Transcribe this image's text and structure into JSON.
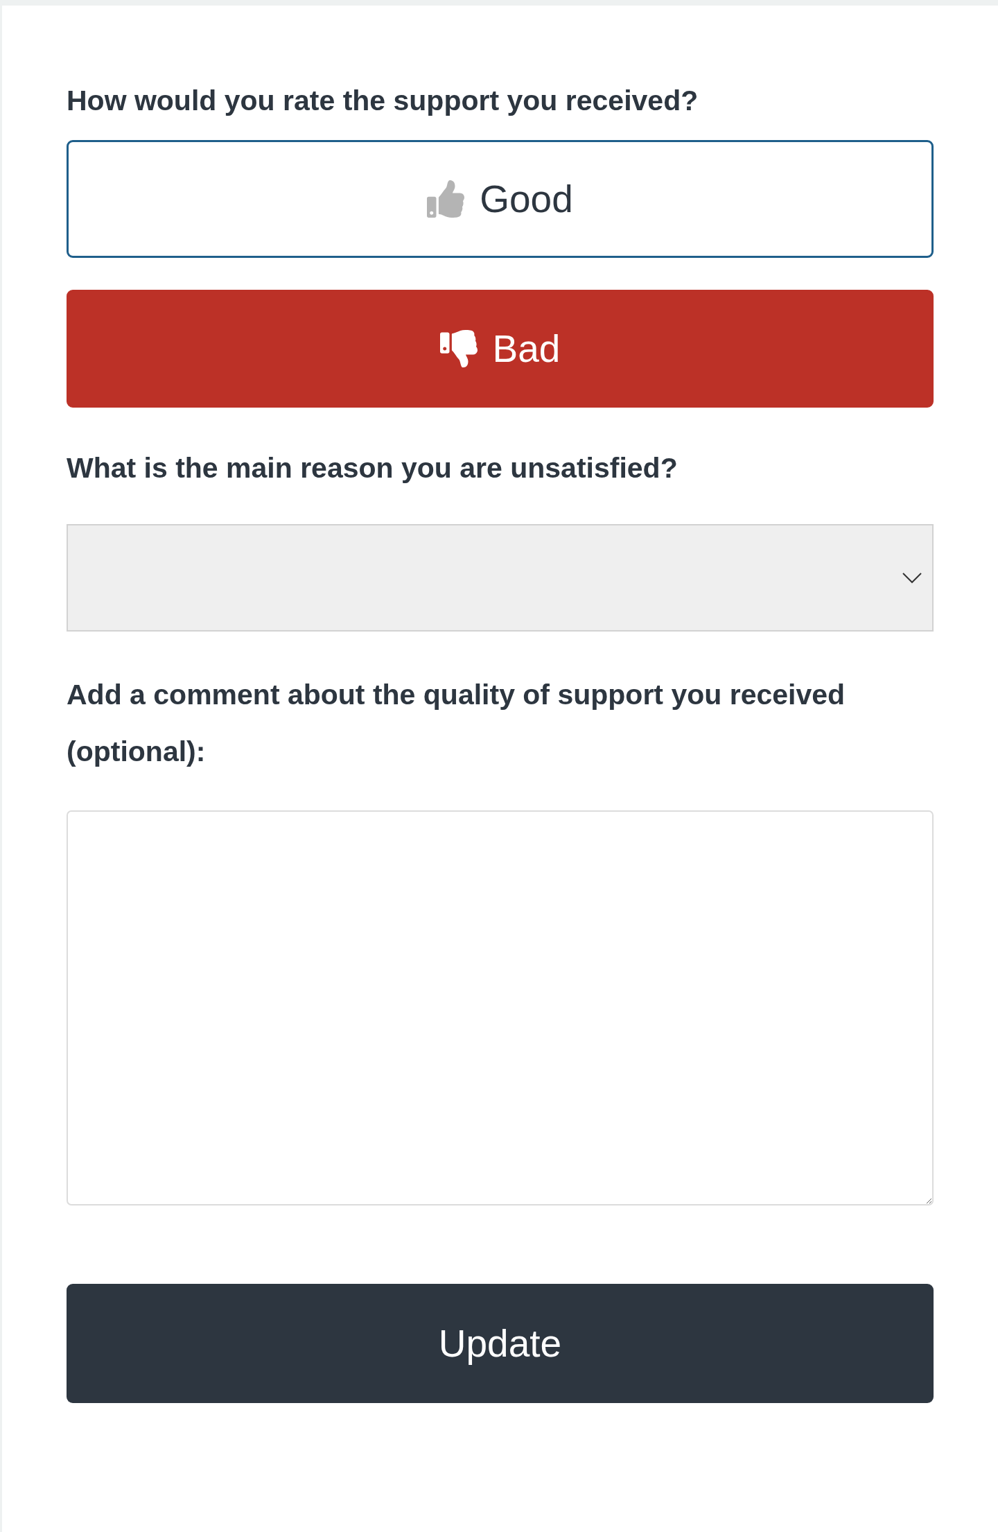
{
  "rating": {
    "question": "How would you rate the support you received?",
    "options": [
      {
        "kind": "thumbs_up",
        "label": "Good",
        "selected": false
      },
      {
        "kind": "thumbs_down",
        "label": "Bad",
        "selected": true
      }
    ]
  },
  "reason": {
    "question": "What is the main reason you are unsatisfied?"
  },
  "comment": {
    "question": "Add a comment about the quality of support you received (optional):"
  },
  "submit": {
    "label": "Update"
  }
}
